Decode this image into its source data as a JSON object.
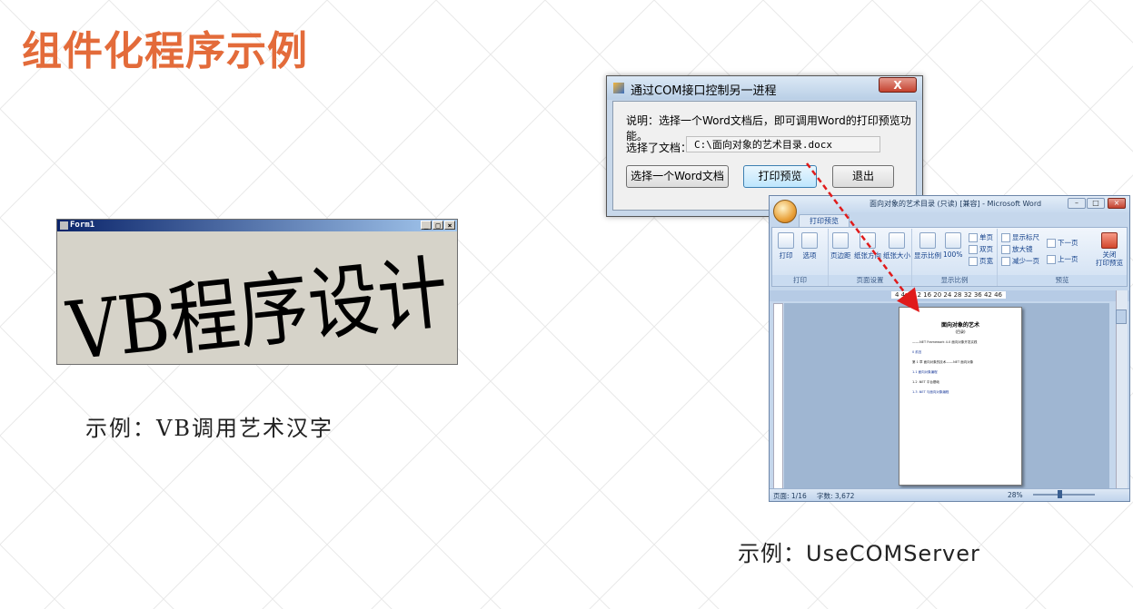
{
  "slide": {
    "title": "组件化程序示例",
    "accent_color": "#e36b3a"
  },
  "vb_example": {
    "window_title": "Form1",
    "art_text": "VB程序设计",
    "caption": "示例：VB调用艺术汉字"
  },
  "com_example": {
    "caption": "示例：UseCOMServer",
    "dialog": {
      "title": "通过COM接口控制另一进程",
      "close_label": "X",
      "description": "说明：选择一个Word文档后，即可调用Word的打印预览功能。",
      "file_label": "选择了文档：",
      "file_path": "C:\\面向对象的艺术目录.docx",
      "buttons": {
        "select": "选择一个Word文档",
        "preview": "打印预览",
        "exit": "退出"
      }
    },
    "word_window": {
      "title": "面向对象的艺术目录 (只读) [兼容] - Microsoft Word",
      "tab": "打印预览",
      "groups": {
        "print": {
          "label": "打印",
          "items": [
            "打印",
            "选项"
          ]
        },
        "page_setup": {
          "label": "页面设置",
          "items": [
            "页边距",
            "纸张方向",
            "纸张大小"
          ]
        },
        "zoom": {
          "label": "显示比例",
          "items": [
            "显示比例",
            "100%"
          ],
          "small": [
            "单页",
            "双页",
            "页宽"
          ]
        },
        "preview": {
          "label": "预览",
          "checks": [
            "显示标尺",
            "放大镜"
          ],
          "small": [
            "减少一页",
            "下一页",
            "上一页"
          ],
          "close": "关闭\n打印预览"
        }
      },
      "ruler_text": "4  4  8  12  16  20  24  28  32  36  42  46",
      "status": {
        "page": "页面: 1/16",
        "words": "字数: 3,672",
        "zoom": "28%"
      },
      "document": {
        "heading": "面向对象的艺术",
        "subheading": "(目录)",
        "lines": [
          "——.NET Framework 4.0 面向对象开发实践",
          "0 前言",
          "第 1 章 面向对象的技术——.NET 面向对象",
          "1.1 面向对象编程",
          "1.2 .NET 平台基础",
          "1.3 .NET 与面向对象编程"
        ]
      }
    }
  }
}
